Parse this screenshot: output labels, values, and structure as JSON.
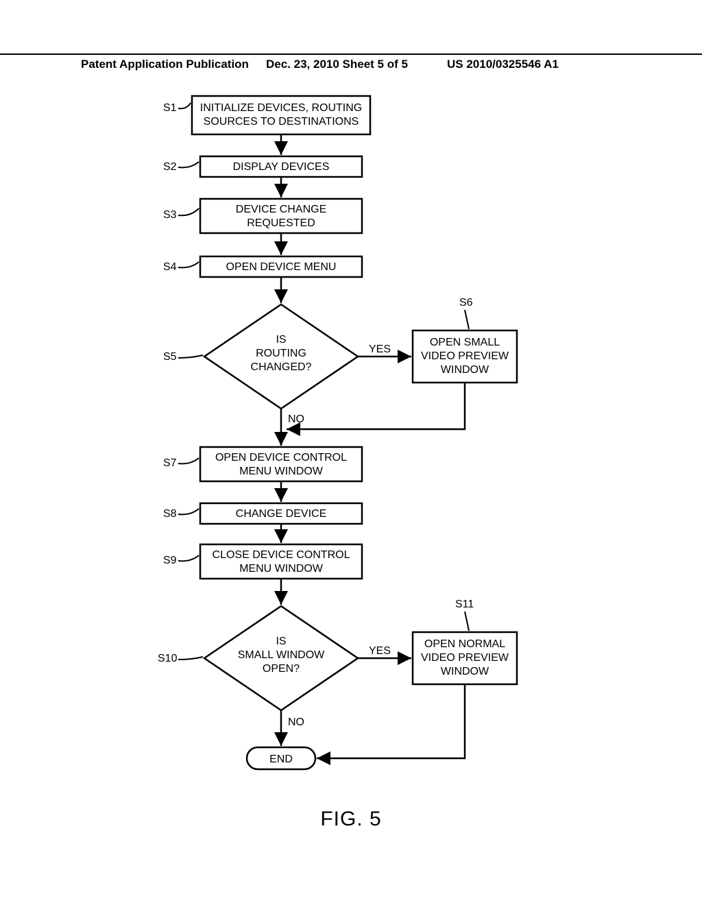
{
  "header": {
    "left": "Patent Application Publication",
    "middle": "Dec. 23, 2010  Sheet 5 of 5",
    "right": "US 2010/0325546 A1"
  },
  "figure_caption": "FIG. 5",
  "steps": {
    "s1": {
      "label": "S1",
      "text1": "INITIALIZE DEVICES, ROUTING",
      "text2": "SOURCES TO DESTINATIONS"
    },
    "s2": {
      "label": "S2",
      "text1": "DISPLAY DEVICES"
    },
    "s3": {
      "label": "S3",
      "text1": "DEVICE CHANGE",
      "text2": "REQUESTED"
    },
    "s4": {
      "label": "S4",
      "text1": "OPEN DEVICE MENU"
    },
    "s5": {
      "label": "S5",
      "text1": "IS",
      "text2": "ROUTING",
      "text3": "CHANGED?"
    },
    "s6": {
      "label": "S6",
      "text0": "OPEN SMALL",
      "text1": "VIDEO PREVIEW",
      "text2": "WINDOW"
    },
    "s7": {
      "label": "S7",
      "text1": "OPEN DEVICE CONTROL",
      "text2": "MENU WINDOW"
    },
    "s8": {
      "label": "S8",
      "text1": "CHANGE DEVICE"
    },
    "s9": {
      "label": "S9",
      "text1": "CLOSE DEVICE CONTROL",
      "text2": "MENU WINDOW"
    },
    "s10": {
      "label": "S10",
      "text1": "IS",
      "text2": "SMALL WINDOW",
      "text3": "OPEN?"
    },
    "s11": {
      "label": "S11",
      "text0": "OPEN NORMAL",
      "text1": "VIDEO PREVIEW",
      "text2": "WINDOW"
    },
    "end": {
      "text": "END"
    }
  },
  "labels": {
    "yes": "YES",
    "no": "NO"
  }
}
